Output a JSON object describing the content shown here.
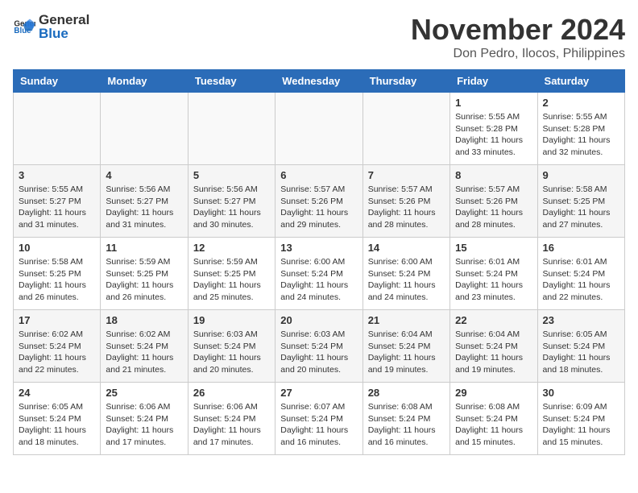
{
  "header": {
    "logo_general": "General",
    "logo_blue": "Blue",
    "month_title": "November 2024",
    "location": "Don Pedro, Ilocos, Philippines"
  },
  "weekdays": [
    "Sunday",
    "Monday",
    "Tuesday",
    "Wednesday",
    "Thursday",
    "Friday",
    "Saturday"
  ],
  "weeks": [
    [
      {
        "day": "",
        "info": ""
      },
      {
        "day": "",
        "info": ""
      },
      {
        "day": "",
        "info": ""
      },
      {
        "day": "",
        "info": ""
      },
      {
        "day": "",
        "info": ""
      },
      {
        "day": "1",
        "info": "Sunrise: 5:55 AM\nSunset: 5:28 PM\nDaylight: 11 hours and 33 minutes."
      },
      {
        "day": "2",
        "info": "Sunrise: 5:55 AM\nSunset: 5:28 PM\nDaylight: 11 hours and 32 minutes."
      }
    ],
    [
      {
        "day": "3",
        "info": "Sunrise: 5:55 AM\nSunset: 5:27 PM\nDaylight: 11 hours and 31 minutes."
      },
      {
        "day": "4",
        "info": "Sunrise: 5:56 AM\nSunset: 5:27 PM\nDaylight: 11 hours and 31 minutes."
      },
      {
        "day": "5",
        "info": "Sunrise: 5:56 AM\nSunset: 5:27 PM\nDaylight: 11 hours and 30 minutes."
      },
      {
        "day": "6",
        "info": "Sunrise: 5:57 AM\nSunset: 5:26 PM\nDaylight: 11 hours and 29 minutes."
      },
      {
        "day": "7",
        "info": "Sunrise: 5:57 AM\nSunset: 5:26 PM\nDaylight: 11 hours and 28 minutes."
      },
      {
        "day": "8",
        "info": "Sunrise: 5:57 AM\nSunset: 5:26 PM\nDaylight: 11 hours and 28 minutes."
      },
      {
        "day": "9",
        "info": "Sunrise: 5:58 AM\nSunset: 5:25 PM\nDaylight: 11 hours and 27 minutes."
      }
    ],
    [
      {
        "day": "10",
        "info": "Sunrise: 5:58 AM\nSunset: 5:25 PM\nDaylight: 11 hours and 26 minutes."
      },
      {
        "day": "11",
        "info": "Sunrise: 5:59 AM\nSunset: 5:25 PM\nDaylight: 11 hours and 26 minutes."
      },
      {
        "day": "12",
        "info": "Sunrise: 5:59 AM\nSunset: 5:25 PM\nDaylight: 11 hours and 25 minutes."
      },
      {
        "day": "13",
        "info": "Sunrise: 6:00 AM\nSunset: 5:24 PM\nDaylight: 11 hours and 24 minutes."
      },
      {
        "day": "14",
        "info": "Sunrise: 6:00 AM\nSunset: 5:24 PM\nDaylight: 11 hours and 24 minutes."
      },
      {
        "day": "15",
        "info": "Sunrise: 6:01 AM\nSunset: 5:24 PM\nDaylight: 11 hours and 23 minutes."
      },
      {
        "day": "16",
        "info": "Sunrise: 6:01 AM\nSunset: 5:24 PM\nDaylight: 11 hours and 22 minutes."
      }
    ],
    [
      {
        "day": "17",
        "info": "Sunrise: 6:02 AM\nSunset: 5:24 PM\nDaylight: 11 hours and 22 minutes."
      },
      {
        "day": "18",
        "info": "Sunrise: 6:02 AM\nSunset: 5:24 PM\nDaylight: 11 hours and 21 minutes."
      },
      {
        "day": "19",
        "info": "Sunrise: 6:03 AM\nSunset: 5:24 PM\nDaylight: 11 hours and 20 minutes."
      },
      {
        "day": "20",
        "info": "Sunrise: 6:03 AM\nSunset: 5:24 PM\nDaylight: 11 hours and 20 minutes."
      },
      {
        "day": "21",
        "info": "Sunrise: 6:04 AM\nSunset: 5:24 PM\nDaylight: 11 hours and 19 minutes."
      },
      {
        "day": "22",
        "info": "Sunrise: 6:04 AM\nSunset: 5:24 PM\nDaylight: 11 hours and 19 minutes."
      },
      {
        "day": "23",
        "info": "Sunrise: 6:05 AM\nSunset: 5:24 PM\nDaylight: 11 hours and 18 minutes."
      }
    ],
    [
      {
        "day": "24",
        "info": "Sunrise: 6:05 AM\nSunset: 5:24 PM\nDaylight: 11 hours and 18 minutes."
      },
      {
        "day": "25",
        "info": "Sunrise: 6:06 AM\nSunset: 5:24 PM\nDaylight: 11 hours and 17 minutes."
      },
      {
        "day": "26",
        "info": "Sunrise: 6:06 AM\nSunset: 5:24 PM\nDaylight: 11 hours and 17 minutes."
      },
      {
        "day": "27",
        "info": "Sunrise: 6:07 AM\nSunset: 5:24 PM\nDaylight: 11 hours and 16 minutes."
      },
      {
        "day": "28",
        "info": "Sunrise: 6:08 AM\nSunset: 5:24 PM\nDaylight: 11 hours and 16 minutes."
      },
      {
        "day": "29",
        "info": "Sunrise: 6:08 AM\nSunset: 5:24 PM\nDaylight: 11 hours and 15 minutes."
      },
      {
        "day": "30",
        "info": "Sunrise: 6:09 AM\nSunset: 5:24 PM\nDaylight: 11 hours and 15 minutes."
      }
    ]
  ]
}
